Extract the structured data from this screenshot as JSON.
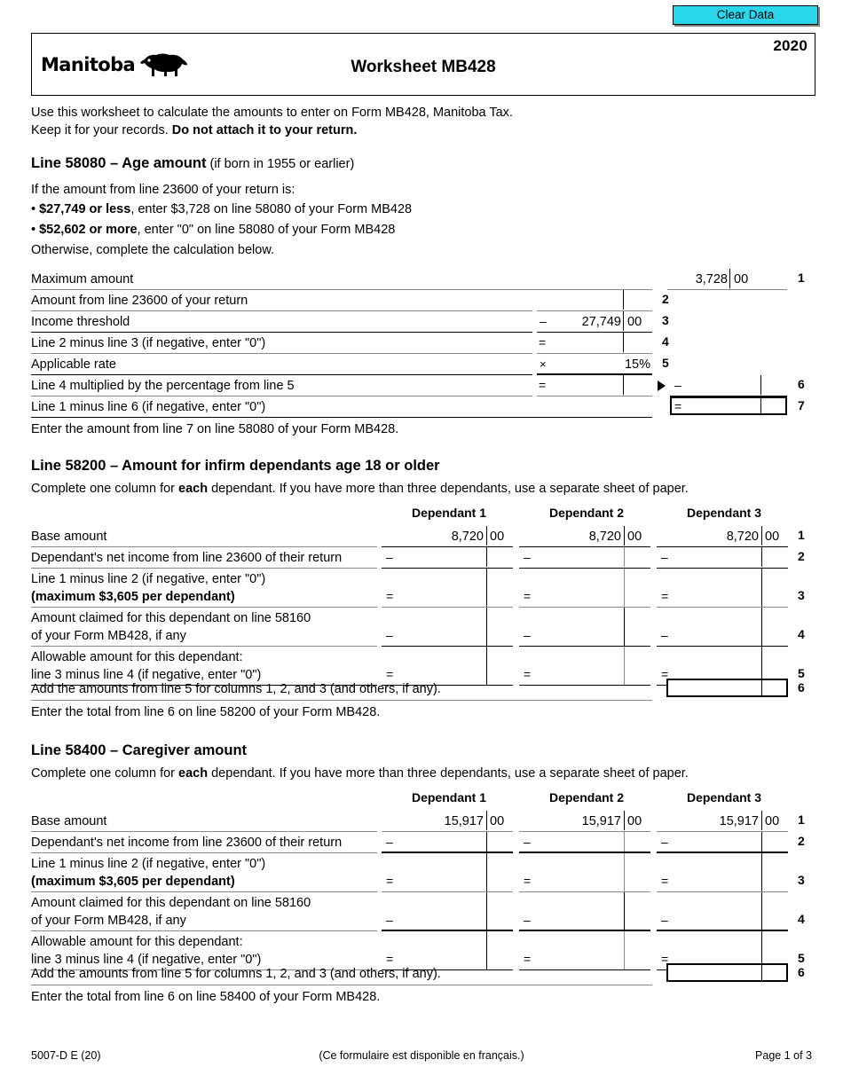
{
  "toolbar": {
    "clear_data_label": "Clear Data"
  },
  "header": {
    "province": "Manitoba",
    "bison_icon": "bison-icon",
    "title": "Worksheet MB428",
    "year": "2020"
  },
  "intro": {
    "line1": "Use this worksheet to calculate the amounts to enter on Form MB428, Manitoba Tax.",
    "line2_plain": "Keep it for your records. ",
    "line2_bold": "Do not attach it to your return."
  },
  "section_age": {
    "heading_bold": "Line 58080 – Age amount",
    "heading_rest": "(if born in 1955 or earlier)",
    "lead": "If the amount from line 23600 of your return is:",
    "bullet1_bold": "$27,749 or less",
    "bullet1_rest": ", enter $3,728 on line 58080 of your Form MB428",
    "bullet2_bold": "$52,602 or more",
    "bullet2_rest": ", enter \"0\" on line 58080 of your Form MB428",
    "otherwise": "Otherwise, complete the calculation below.",
    "rows": [
      {
        "label": "Maximum amount",
        "no": "1",
        "op": "",
        "value": "3,728",
        "cents": "00"
      },
      {
        "label": "Amount from line 23600 of your return",
        "no": "2",
        "op": "",
        "value": "",
        "cents": ""
      },
      {
        "label": "Income threshold",
        "no": "3",
        "op": "–",
        "value": "27,749",
        "cents": "00"
      },
      {
        "label": "Line 2 minus line 3 (if negative, enter \"0\")",
        "no": "4",
        "op": "=",
        "value": "",
        "cents": ""
      },
      {
        "label": "Applicable rate",
        "no": "5",
        "op": "×",
        "value": "15%",
        "cents": ""
      },
      {
        "label": "Line 4 multiplied by the percentage from line 5",
        "no": "6",
        "op": "=",
        "value": "",
        "cents": ""
      },
      {
        "label": "Line 1 minus line 6 (if negative, enter \"0\")",
        "no": "7",
        "op": "=",
        "value": "",
        "cents": ""
      }
    ],
    "carry_op": "–",
    "total_op": "=",
    "footnote": "Enter the amount from line 7 on line 58080 of your Form MB428."
  },
  "section_infirm": {
    "heading": "Line 58200 – Amount for infirm dependants age 18 or older",
    "instr_a": "Complete one column for ",
    "instr_b": "each",
    "instr_c": " dependant. If you have more than three dependants, use a separate sheet of paper.",
    "columns": [
      "Dependant 1",
      "Dependant 2",
      "Dependant 3"
    ],
    "rows": [
      {
        "no": "1",
        "label_l1": "Base amount",
        "label_l2": "",
        "label_l2_bold": false,
        "op": "",
        "value": "8,720",
        "cents": "00"
      },
      {
        "no": "2",
        "label_l1": "Dependant's net income from line 23600 of their return",
        "label_l2": "",
        "label_l2_bold": false,
        "op": "–",
        "value": "",
        "cents": ""
      },
      {
        "no": "3",
        "label_l1": "Line 1 minus line 2 (if negative, enter \"0\")",
        "label_l2": "(maximum $3,605 per dependant)",
        "label_l2_bold": true,
        "op": "=",
        "value": "",
        "cents": ""
      },
      {
        "no": "4",
        "label_l1": "Amount claimed for this dependant on line 58160",
        "label_l2": "of your Form MB428, if any",
        "label_l2_bold": false,
        "op": "–",
        "value": "",
        "cents": ""
      },
      {
        "no": "5",
        "label_l1": "Allowable amount for this dependant:",
        "label_l2": "line 3 minus line 4 (if negative, enter \"0\")",
        "label_l2_bold": false,
        "op": "=",
        "value": "",
        "cents": ""
      }
    ],
    "total_row": {
      "no": "6",
      "label": "Add the amounts from line 5 for columns 1, 2, and 3 (and others, if any)."
    },
    "footnote": "Enter the total from line 6 on line 58200 of your Form MB428."
  },
  "section_caregiver": {
    "heading": "Line 58400 – Caregiver amount",
    "instr_a": "Complete one column for ",
    "instr_b": "each",
    "instr_c": " dependant. If you have more than three dependants, use a separate sheet of paper.",
    "columns": [
      "Dependant 1",
      "Dependant 2",
      "Dependant 3"
    ],
    "rows": [
      {
        "no": "1",
        "label_l1": "Base amount",
        "label_l2": "",
        "label_l2_bold": false,
        "op": "",
        "value": "15,917",
        "cents": "00"
      },
      {
        "no": "2",
        "label_l1": "Dependant's net income from line 23600 of their return",
        "label_l2": "",
        "label_l2_bold": false,
        "op": "–",
        "value": "",
        "cents": ""
      },
      {
        "no": "3",
        "label_l1": "Line 1 minus line 2 (if negative, enter \"0\")",
        "label_l2": "(maximum $3,605 per dependant)",
        "label_l2_bold": true,
        "op": "=",
        "value": "",
        "cents": ""
      },
      {
        "no": "4",
        "label_l1": "Amount claimed for this dependant on line 58160",
        "label_l2": "of your Form MB428, if any",
        "label_l2_bold": false,
        "op": "–",
        "value": "",
        "cents": ""
      },
      {
        "no": "5",
        "label_l1": "Allowable amount for this dependant:",
        "label_l2": "line 3 minus line 4 (if negative, enter \"0\")",
        "label_l2_bold": false,
        "op": "=",
        "value": "",
        "cents": ""
      }
    ],
    "total_row": {
      "no": "6",
      "label": "Add the amounts from line 5 for columns 1, 2, and 3 (and others, if any)."
    },
    "footnote": "Enter the total from line 6 on line 58400 of your Form MB428."
  },
  "footer": {
    "form_code": "5007-D E (20)",
    "french_note": "(Ce formulaire est disponible en français.)",
    "page": "Page 1 of 3"
  }
}
